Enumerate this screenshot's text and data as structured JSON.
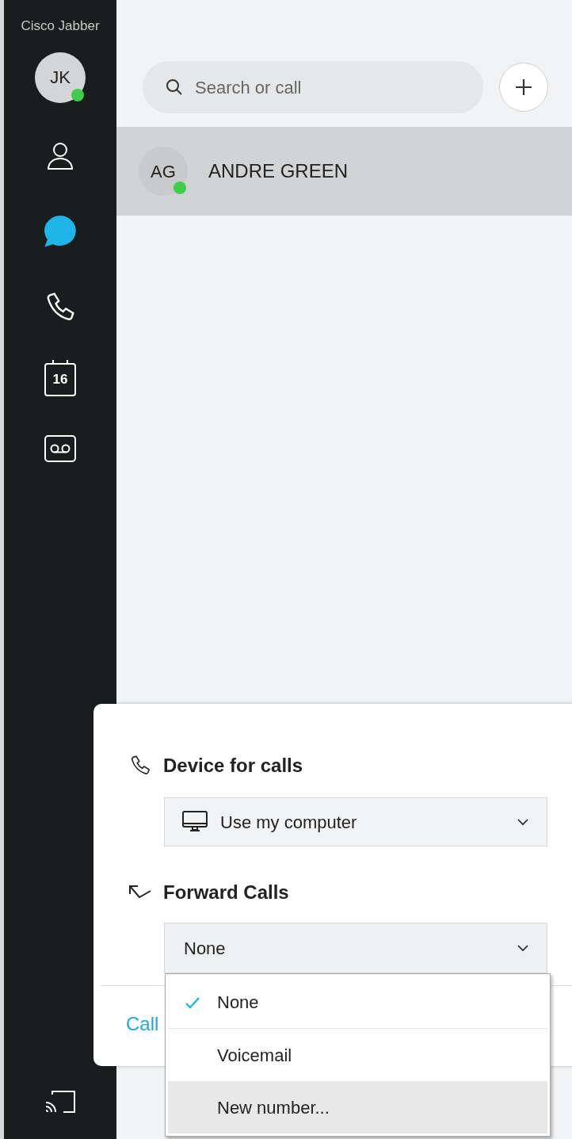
{
  "app": {
    "title": "Cisco Jabber"
  },
  "user": {
    "initials": "JK",
    "online": true
  },
  "nav": [
    {
      "kind": "contacts",
      "selected": false
    },
    {
      "kind": "chats",
      "selected": true
    },
    {
      "kind": "calls",
      "selected": false
    },
    {
      "kind": "meetings",
      "selected": false,
      "badge": "16"
    },
    {
      "kind": "voicemail",
      "selected": false
    }
  ],
  "search": {
    "placeholder": "Search or call"
  },
  "conversations": [
    {
      "initials": "AG",
      "name": "ANDRE GREEN",
      "online": true,
      "selected": true
    }
  ],
  "call_settings": {
    "device": {
      "heading": "Device for calls",
      "value": "Use my computer"
    },
    "forward": {
      "heading": "Forward Calls",
      "value": "None",
      "expanded": true,
      "options": [
        {
          "label": "None",
          "selected": true,
          "highlighted": false
        },
        {
          "label": "Voicemail",
          "selected": false,
          "highlighted": false
        },
        {
          "label": "New number...",
          "selected": false,
          "highlighted": true
        }
      ]
    },
    "link": "Call"
  }
}
